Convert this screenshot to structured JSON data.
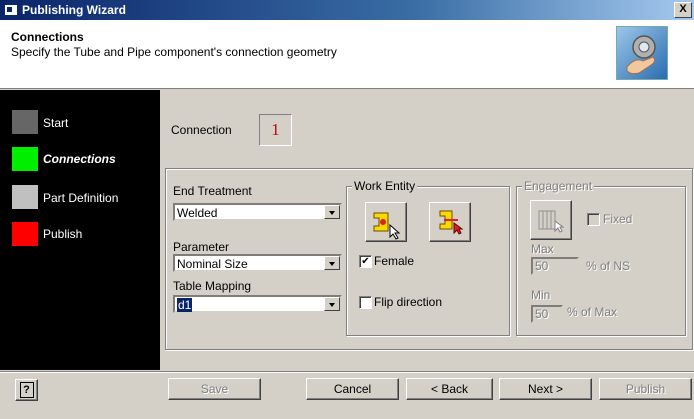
{
  "window": {
    "title": "Publishing Wizard",
    "close_label": "X"
  },
  "header": {
    "title": "Connections",
    "subtitle": "Specify the Tube and Pipe component's connection geometry",
    "image_icon": "hand-gear-icon"
  },
  "nav": {
    "steps": [
      {
        "label": "Start",
        "color": "#666666",
        "active": false
      },
      {
        "label": "Connections",
        "color": "#00ee00",
        "active": true
      },
      {
        "label": "Part Definition",
        "color": "#c0c0c0",
        "active": false
      },
      {
        "label": "Publish",
        "color": "#ff0000",
        "active": false
      }
    ]
  },
  "connection": {
    "label": "Connection",
    "value": "1"
  },
  "end_treatment": {
    "label": "End Treatment",
    "value": "Welded"
  },
  "parameter": {
    "label": "Parameter",
    "value": "Nominal Size"
  },
  "table_mapping": {
    "label": "Table Mapping",
    "value": "d1"
  },
  "work_entity": {
    "group_label": "Work Entity",
    "female_label": "Female",
    "female_checked": true,
    "flip_label": "Flip direction",
    "flip_checked": false
  },
  "engagement": {
    "group_label": "Engagement",
    "fixed_label": "Fixed",
    "max_label": "Max",
    "max_value": "50",
    "max_unit": "% of NS",
    "min_label": "Min",
    "min_value": "50",
    "min_unit": "% of Max"
  },
  "footer": {
    "help_label": "?",
    "save_label": "Save",
    "cancel_label": "Cancel",
    "back_label": "< Back",
    "next_label": "Next >",
    "publish_label": "Publish"
  }
}
